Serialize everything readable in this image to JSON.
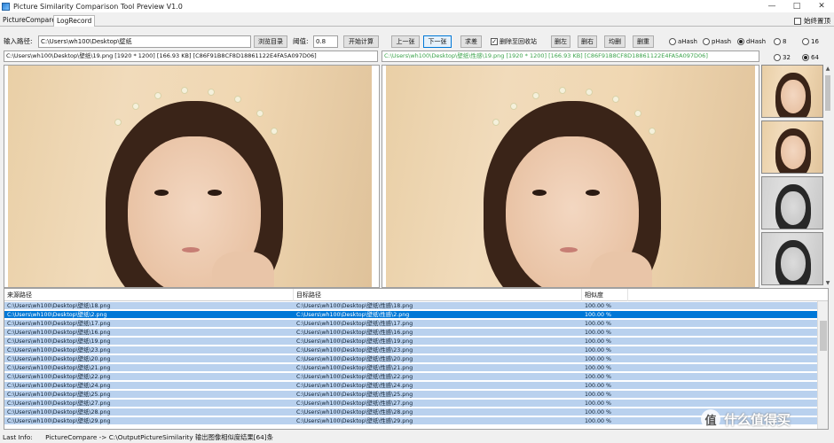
{
  "window": {
    "title": "Picture Similarity Comparison Tool Preview V1.0",
    "min_icon": "minimize-icon",
    "max_icon": "maximize-icon",
    "close_icon": "close-icon"
  },
  "tabs": [
    {
      "label": "PictureCompare",
      "active": false
    },
    {
      "label": "LogRecord",
      "active": true
    }
  ],
  "always_on_top": {
    "label": "始终置顶",
    "checked": false
  },
  "toolbar": {
    "input_path_label": "输入路径:",
    "input_path_value": "C:\\Users\\wh100\\Desktop\\壁纸",
    "browse_label": "浏览目录",
    "threshold_label": "阈值:",
    "threshold_value": "0.8",
    "start_label": "开始计算",
    "prev_label": "上一张",
    "next_label": "下一张",
    "compare_label": "求差",
    "delete_recycle_label": "删除至回收站",
    "delete_recycle_checked": true,
    "delete_left_label": "删左",
    "delete_right_label": "删右",
    "delete_both_label": "均删",
    "delete_dup_label": "删重"
  },
  "hash_options": [
    {
      "label": "aHash",
      "selected": false
    },
    {
      "label": "pHash",
      "selected": false
    },
    {
      "label": "dHash",
      "selected": true
    }
  ],
  "size_options": [
    {
      "label": "8",
      "selected": false
    },
    {
      "label": "16",
      "selected": false
    },
    {
      "label": "32",
      "selected": false
    },
    {
      "label": "64",
      "selected": true
    }
  ],
  "left_info": "C:\\Users\\wh100\\Desktop\\壁纸\\19.png [1920 * 1200] [166.93 KB] [C86F91B8CF8D18861122E4FA5A097D06]",
  "right_info": "C:\\Users\\wh100\\Desktop\\壁纸\\性感\\19.png [1920 * 1200] [166.93 KB] [C86F91B8CF8D18861122E4FA5A097D06]",
  "colors": {
    "right_info_text": "#3aa34a",
    "row_bg": "#b9d1ee",
    "row_selected": "#0078d7"
  },
  "table": {
    "headers": [
      "来源路径",
      "目标路径",
      "相似度"
    ],
    "rows": [
      {
        "src": "C:\\Users\\wh100\\Desktop\\壁纸\\18.png",
        "dst": "C:\\Users\\wh100\\Desktop\\壁纸\\性感\\18.png",
        "sim": "100.00 %",
        "selected": false
      },
      {
        "src": "C:\\Users\\wh100\\Desktop\\壁纸\\2.png",
        "dst": "C:\\Users\\wh100\\Desktop\\壁纸\\性感\\2.png",
        "sim": "100.00 %",
        "selected": true
      },
      {
        "src": "C:\\Users\\wh100\\Desktop\\壁纸\\17.png",
        "dst": "C:\\Users\\wh100\\Desktop\\壁纸\\性感\\17.png",
        "sim": "100.00 %",
        "selected": false
      },
      {
        "src": "C:\\Users\\wh100\\Desktop\\壁纸\\16.png",
        "dst": "C:\\Users\\wh100\\Desktop\\壁纸\\性感\\16.png",
        "sim": "100.00 %",
        "selected": false
      },
      {
        "src": "C:\\Users\\wh100\\Desktop\\壁纸\\19.png",
        "dst": "C:\\Users\\wh100\\Desktop\\壁纸\\性感\\19.png",
        "sim": "100.00 %",
        "selected": false
      },
      {
        "src": "C:\\Users\\wh100\\Desktop\\壁纸\\23.png",
        "dst": "C:\\Users\\wh100\\Desktop\\壁纸\\性感\\23.png",
        "sim": "100.00 %",
        "selected": false
      },
      {
        "src": "C:\\Users\\wh100\\Desktop\\壁纸\\20.png",
        "dst": "C:\\Users\\wh100\\Desktop\\壁纸\\性感\\20.png",
        "sim": "100.00 %",
        "selected": false
      },
      {
        "src": "C:\\Users\\wh100\\Desktop\\壁纸\\21.png",
        "dst": "C:\\Users\\wh100\\Desktop\\壁纸\\性感\\21.png",
        "sim": "100.00 %",
        "selected": false
      },
      {
        "src": "C:\\Users\\wh100\\Desktop\\壁纸\\22.png",
        "dst": "C:\\Users\\wh100\\Desktop\\壁纸\\性感\\22.png",
        "sim": "100.00 %",
        "selected": false
      },
      {
        "src": "C:\\Users\\wh100\\Desktop\\壁纸\\24.png",
        "dst": "C:\\Users\\wh100\\Desktop\\壁纸\\性感\\24.png",
        "sim": "100.00 %",
        "selected": false
      },
      {
        "src": "C:\\Users\\wh100\\Desktop\\壁纸\\25.png",
        "dst": "C:\\Users\\wh100\\Desktop\\壁纸\\性感\\25.png",
        "sim": "100.00 %",
        "selected": false
      },
      {
        "src": "C:\\Users\\wh100\\Desktop\\壁纸\\27.png",
        "dst": "C:\\Users\\wh100\\Desktop\\壁纸\\性感\\27.png",
        "sim": "100.00 %",
        "selected": false
      },
      {
        "src": "C:\\Users\\wh100\\Desktop\\壁纸\\28.png",
        "dst": "C:\\Users\\wh100\\Desktop\\壁纸\\性感\\28.png",
        "sim": "100.00 %",
        "selected": false
      },
      {
        "src": "C:\\Users\\wh100\\Desktop\\壁纸\\29.png",
        "dst": "C:\\Users\\wh100\\Desktop\\壁纸\\性感\\29.png",
        "sim": "100.00 %",
        "selected": false
      }
    ]
  },
  "status": {
    "label": "Last Info:",
    "text": "PictureCompare -> C:\\OutputPictureSimilarity 输出图像相似度结果[64]条"
  },
  "watermark": {
    "text": "值 什么值得买",
    "icon": "zhi-logo-icon"
  }
}
